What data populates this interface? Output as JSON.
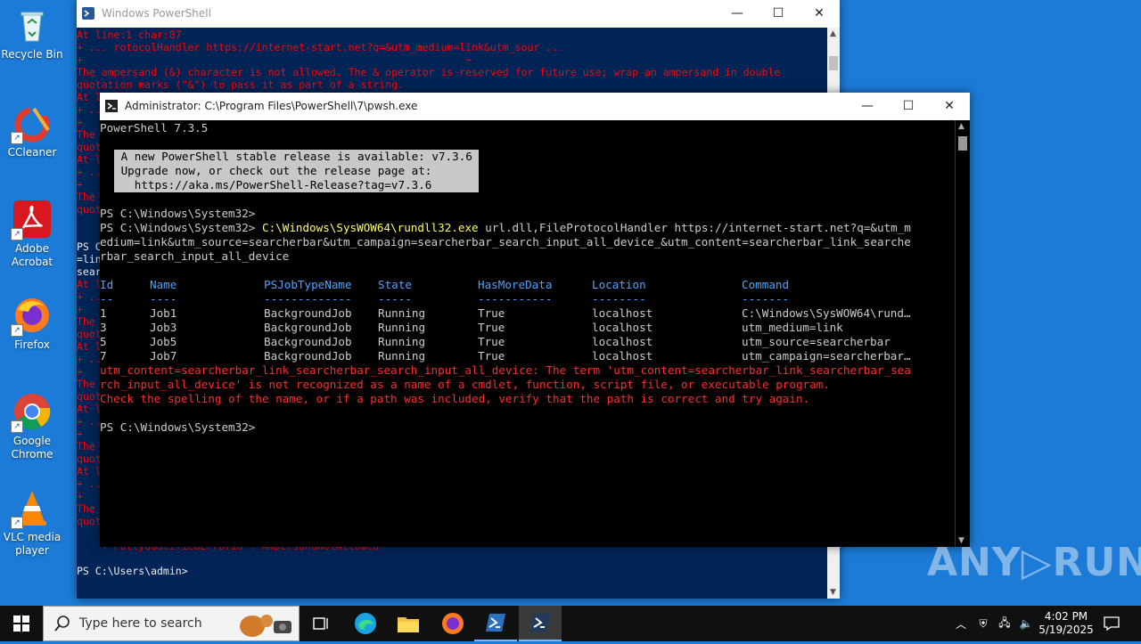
{
  "desktop": {
    "icons": [
      {
        "label": "Recycle Bin"
      },
      {
        "label": "CCleaner"
      },
      {
        "label": "Adobe Acrobat"
      },
      {
        "label": "Firefox"
      },
      {
        "label": "Google Chrome"
      },
      {
        "label": "VLC media player"
      }
    ]
  },
  "back_window": {
    "title": "Windows PowerShell",
    "lines": [
      "At line:1 char:87",
      "+ ... rotocolHandler https://internet-start.net?q=&utm_medium=link&utm_sour ...",
      "+                                                              ~",
      "The ampersand (&) character is not allowed. The & operator is reserved for future use; wrap an ampersand in double",
      "quotation marks (\"&\") to pass it as part of a string.",
      "At l",
      "+ ..",
      "+",
      "The",
      "quot",
      "At l",
      "+ ..",
      "+",
      "The",
      "quot",
      "",
      "",
      "PS C",
      "=lin",
      "sear",
      "At l",
      "+ ..",
      "+",
      "The",
      "quot",
      "At l",
      "+ ..",
      "+",
      "The",
      "quot",
      "At l",
      "+ ..",
      "+",
      "The",
      "quot",
      "At l",
      "+ ..",
      "+",
      "The",
      "quot",
      "",
      "    + FullyQualifiedErrorId : AmpersandNotAllowed",
      "",
      "PS C:\\Users\\admin>"
    ]
  },
  "front_window": {
    "title": "Administrator: C:\\Program Files\\PowerShell\\7\\pwsh.exe",
    "version_line": "PowerShell 7.3.5",
    "update_lines": [
      " A new PowerShell stable release is available: v7.3.6 ",
      " Upgrade now, or check out the release page at:       ",
      "   https://aka.ms/PowerShell-Release?tag=v7.3.6       "
    ],
    "prompt1": "PS C:\\Windows\\System32>",
    "prompt2": "PS C:\\Windows\\System32> ",
    "cmd_exe": "C:\\Windows\\SysWOW64\\rundll32.exe",
    "cmd_args1": " url.dll,FileProtocolHandler https://internet-start.net?q=&utm_m",
    "cmd_args2": "edium=link&utm_source=searcherbar&utm_campaign=searcherbar_search_input_all_device_&utm_content=searcherbar_link_searche",
    "cmd_args3": "rbar_search_input_all_device",
    "table": {
      "headers": [
        "Id",
        "Name",
        "PSJobTypeName",
        "State",
        "HasMoreData",
        "Location",
        "Command"
      ],
      "underlines": [
        "--",
        "----",
        "-------------",
        "-----",
        "-----------",
        "--------",
        "-------"
      ],
      "rows": [
        [
          "1",
          "Job1",
          "BackgroundJob",
          "Running",
          "True",
          "localhost",
          "C:\\Windows\\SysWOW64\\rund…"
        ],
        [
          "3",
          "Job3",
          "BackgroundJob",
          "Running",
          "True",
          "localhost",
          "utm_medium=link"
        ],
        [
          "5",
          "Job5",
          "BackgroundJob",
          "Running",
          "True",
          "localhost",
          "utm_source=searcherbar"
        ],
        [
          "7",
          "Job7",
          "BackgroundJob",
          "Running",
          "True",
          "localhost",
          "utm_campaign=searcherbar…"
        ]
      ]
    },
    "error_lines": [
      "utm_content=searcherbar_link_searcherbar_search_input_all_device: The term 'utm_content=searcherbar_link_searcherbar_sea",
      "rch_input_all_device' is not recognized as a name of a cmdlet, function, script file, or executable program.",
      "Check the spelling of the name, or if a path was included, verify that the path is correct and try again."
    ],
    "prompt3": "PS C:\\Windows\\System32>"
  },
  "taskbar": {
    "search_placeholder": "Type here to search",
    "time": "4:02 PM",
    "date": "5/19/2025"
  },
  "watermark": "ANY▷RUN"
}
